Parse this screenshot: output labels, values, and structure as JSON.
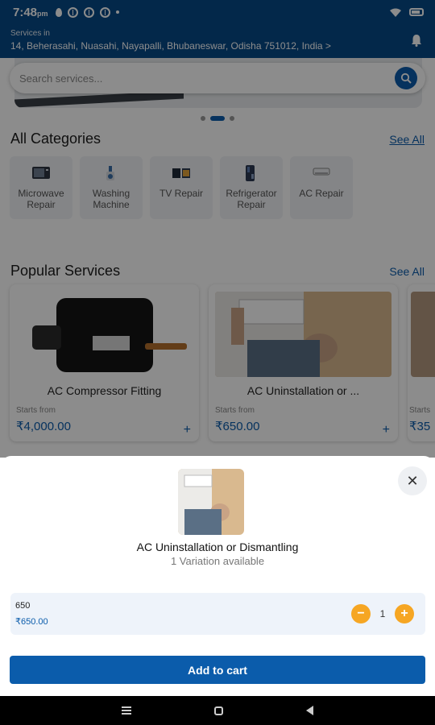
{
  "status_bar": {
    "time": "7:48",
    "ampm": "pm"
  },
  "header": {
    "services_in_label": "Services in",
    "address": "14, Beherasahi, Nuasahi, Nayapalli, Bhubaneswar, Odisha 751012, India >"
  },
  "search": {
    "placeholder": "Search services..."
  },
  "categories": {
    "title": "All Categories",
    "see_all": "See All",
    "items": [
      {
        "label": "Microwave Repair",
        "icon": "microwave-icon"
      },
      {
        "label": "Washing Machine",
        "icon": "washing-machine-icon"
      },
      {
        "label": "TV Repair",
        "icon": "tv-icon"
      },
      {
        "label": "Refrigerator Repair",
        "icon": "refrigerator-icon"
      },
      {
        "label": "AC Repair",
        "icon": "ac-icon"
      }
    ]
  },
  "popular": {
    "title": "Popular Services",
    "see_all": "See All",
    "items": [
      {
        "name": "AC Compressor Fitting",
        "starts_from": "Starts from",
        "price": "₹4,000.00"
      },
      {
        "name": "AC Uninstallation or ...",
        "starts_from": "Starts from",
        "price": "₹650.00"
      },
      {
        "starts_from": "Starts",
        "price": "₹35"
      }
    ]
  },
  "sheet": {
    "title": "AC Uninstallation or Dismantling",
    "subtitle": "1 Variation available",
    "variant": {
      "name": "650",
      "price": "₹650.00",
      "quantity": "1"
    },
    "add_to_cart": "Add to cart",
    "close_symbol": "✕"
  },
  "colors": {
    "primary": "#0b5cab",
    "header": "#074a88",
    "accent": "#f6a623"
  }
}
